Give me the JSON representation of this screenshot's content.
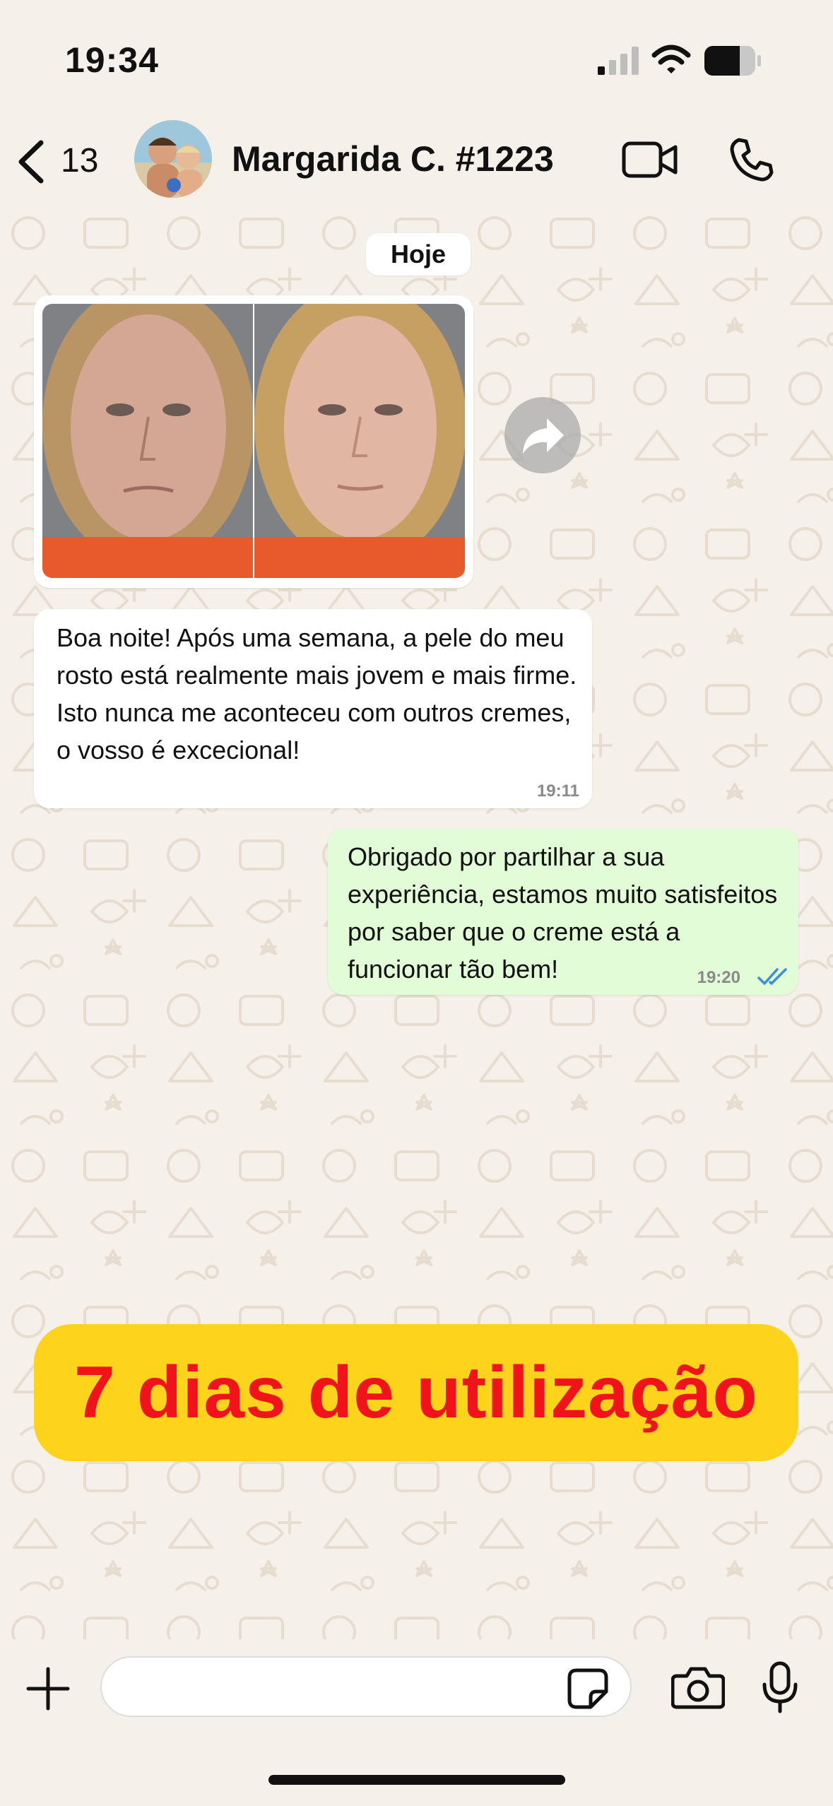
{
  "status": {
    "time": "19:34",
    "icons": [
      "signal-icon",
      "wifi-icon",
      "battery-icon"
    ]
  },
  "header": {
    "back_count": "13",
    "contact_name": "Margarida C. #1223",
    "icons": [
      "chevron-left-icon",
      "video-call-icon",
      "phone-icon"
    ]
  },
  "chat": {
    "date_label": "Hoje",
    "incoming_text": "Boa noite! Após uma semana, a pele do meu rosto está realmente mais jovem e mais firme. Isto nunca me aconteceu com outros cremes, o vosso é excecional!",
    "incoming_time": "19:11",
    "outgoing_text": "Obrigado por partilhar a sua experiência, estamos muito satisfeitos por saber que o creme está a funcionar tão bem!",
    "outgoing_time": "19:20",
    "read_status": "double-check-icon"
  },
  "banner": {
    "text": "7 dias de utilização",
    "background": "#fdd31c",
    "color": "#f0141a"
  },
  "input": {
    "value": "",
    "icons": [
      "plus-icon",
      "sticker-icon",
      "camera-icon",
      "microphone-icon"
    ]
  },
  "colors": {
    "background": "#f5f1ea",
    "outgoing_bubble": "#e1fcd6",
    "incoming_bubble": "#ffffff",
    "read_ticks": "#3b8fd9"
  }
}
